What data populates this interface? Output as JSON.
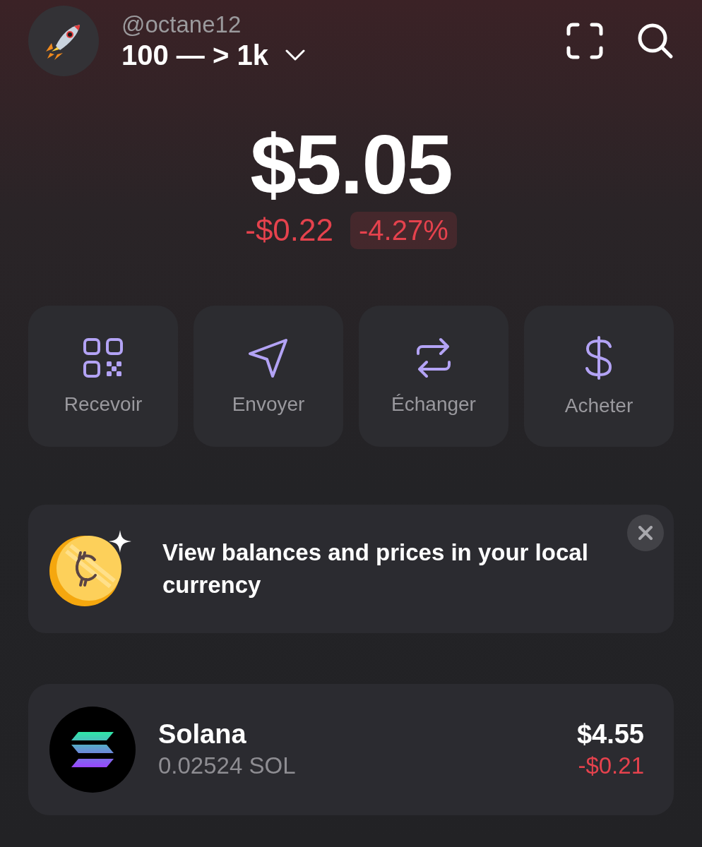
{
  "account": {
    "handle": "@octane12",
    "name": "100 — > 1k"
  },
  "balance": {
    "total": "$5.05",
    "change": "-$0.22",
    "percent": "-4.27%",
    "negative": true
  },
  "actions": [
    {
      "kind": "qr",
      "label": "Recevoir"
    },
    {
      "kind": "send",
      "label": "Envoyer"
    },
    {
      "kind": "swap",
      "label": "Échanger"
    },
    {
      "kind": "buy",
      "label": "Acheter"
    }
  ],
  "banner": {
    "text": "View balances and prices in your local currency"
  },
  "tokens": [
    {
      "name": "Solana",
      "amount": "0.02524 SOL",
      "value": "$4.55",
      "change": "-$0.21",
      "negative": true
    }
  ]
}
